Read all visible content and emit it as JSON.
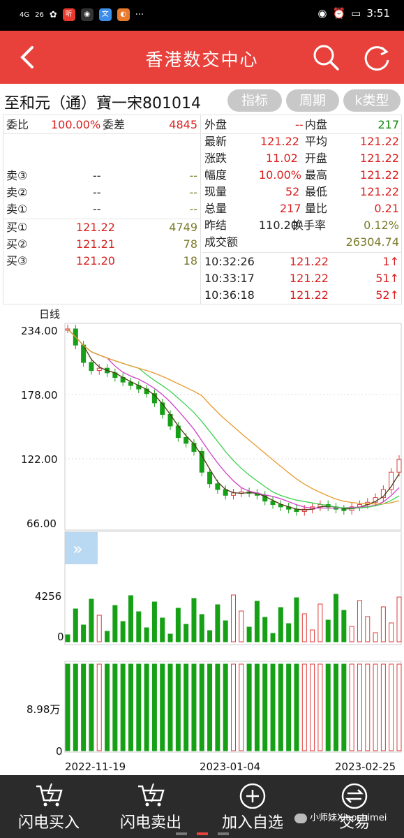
{
  "status_bar": {
    "left_signals": [
      "4G",
      "26"
    ],
    "time": "3:51"
  },
  "header": {
    "title": "香港数交中心",
    "back_icon": "chevron-left-icon",
    "search_icon": "search-icon",
    "refresh_icon": "refresh-icon"
  },
  "stock": {
    "name": "至和元（通）寶一宋801014",
    "buttons": [
      "指标",
      "周期",
      "k类型"
    ]
  },
  "quote": {
    "webi_label": "委比",
    "webi_value": "100.00%",
    "weicha_label": "委差",
    "weicha_value": "4845",
    "sell": [
      {
        "label": "卖③",
        "price": "--",
        "qty": "--"
      },
      {
        "label": "卖②",
        "price": "--",
        "qty": "--"
      },
      {
        "label": "卖①",
        "price": "--",
        "qty": "--"
      }
    ],
    "buy": [
      {
        "label": "买①",
        "price": "121.22",
        "qty": "4749"
      },
      {
        "label": "买②",
        "price": "121.21",
        "qty": "78"
      },
      {
        "label": "买③",
        "price": "121.20",
        "qty": "18"
      }
    ],
    "right": [
      {
        "l1": "外盘",
        "v1": "--",
        "l2": "内盘",
        "v2": "217"
      },
      {
        "l1": "最新",
        "v1": "121.22",
        "l2": "平均",
        "v2": "121.22"
      },
      {
        "l1": "涨跌",
        "v1": "11.02",
        "l2": "开盘",
        "v2": "121.22"
      },
      {
        "l1": "幅度",
        "v1": "10.00%",
        "l2": "最高",
        "v2": "121.22"
      },
      {
        "l1": "现量",
        "v1": "52",
        "l2": "最低",
        "v2": "121.22"
      },
      {
        "l1": "总量",
        "v1": "217",
        "l2": "量比",
        "v2": "0.21"
      },
      {
        "l1": "昨结",
        "v1": "110.20",
        "l2": "换手率",
        "v2": "0.12%"
      },
      {
        "l1": "成交额",
        "v1": "",
        "l2": "",
        "v2": "26304.74"
      }
    ],
    "ticks": [
      {
        "time": "10:32:26",
        "price": "121.22",
        "vol": "1↑"
      },
      {
        "time": "10:33:17",
        "price": "121.22",
        "vol": "51↑"
      },
      {
        "time": "10:36:18",
        "price": "121.22",
        "vol": "52↑"
      }
    ]
  },
  "chart": {
    "period_label": "日线",
    "price_ticks": [
      "234.00",
      "178.00",
      "122.00",
      "66.00"
    ],
    "volume_ticks": [
      "4256",
      "0"
    ],
    "indicator_ticks": [
      "8.98万",
      "0"
    ],
    "dates": [
      "2022-11-19",
      "2023-01-04",
      "2023-02-25"
    ],
    "colors": {
      "up": "#e23a3a",
      "down": "#16a016",
      "ma5": "#4b3a10",
      "ma10": "#d040c8",
      "ma20": "#3cd050",
      "ma60": "#e89a30"
    }
  },
  "chart_data": {
    "type": "candlestick",
    "title": "",
    "ylim": [
      66,
      234
    ],
    "x_labels": [
      "2022-11-19",
      "2023-01-04",
      "2023-02-25"
    ],
    "series": [
      {
        "name": "",
        "values": [
          234,
          220,
          205,
          198,
          200,
          196,
          192,
          188,
          185,
          182,
          178,
          170,
          160,
          150,
          140,
          135,
          128,
          110,
          100,
          95,
          90,
          92,
          93,
          92,
          90,
          85,
          82,
          80,
          78,
          76,
          78,
          80,
          82,
          80,
          78,
          77,
          80,
          82,
          84,
          88,
          95,
          110,
          121
        ]
      }
    ]
  },
  "bottom_nav": {
    "items": [
      {
        "label": "闪电买入",
        "icon": "cart-lightning-icon"
      },
      {
        "label": "闪电卖出",
        "icon": "cart-lightning-icon"
      },
      {
        "label": "加入自选",
        "icon": "plus-circle-icon"
      },
      {
        "label": "交易",
        "icon": "exchange-icon"
      }
    ],
    "watermark": "小师妹Xiaoshimei"
  }
}
